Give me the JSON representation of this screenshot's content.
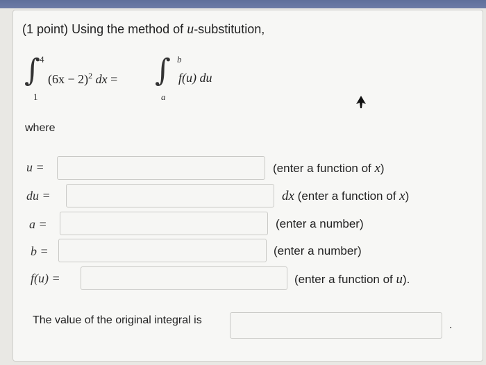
{
  "problem": {
    "points": "(1 point)",
    "intro": "Using the method of",
    "u_symbol": "u",
    "intro_end": "-substitution,"
  },
  "integral": {
    "lower": "1",
    "upper": "4",
    "integrand": "(6x − 2)",
    "exponent": "2",
    "dx": "dx",
    "equals": "=",
    "lower_sub": "a",
    "upper_sub": "b",
    "integrand_sub": "f(u) du"
  },
  "where_text": "where",
  "rows": [
    {
      "label": "u =",
      "value": "",
      "hint_pre": "",
      "hint_text": "(enter a function of ",
      "hint_var": "x",
      "hint_post": ")"
    },
    {
      "label": "du =",
      "value": "",
      "hint_pre": "dx",
      "hint_text": " (enter a function of ",
      "hint_var": "x",
      "hint_post": ")"
    },
    {
      "label": "a =",
      "value": "",
      "hint_pre": "",
      "hint_text": "(enter a number)",
      "hint_var": "",
      "hint_post": ""
    },
    {
      "label": "b =",
      "value": "",
      "hint_pre": "",
      "hint_text": "(enter a number)",
      "hint_var": "",
      "hint_post": ""
    },
    {
      "label": "f(u) =",
      "value": "",
      "hint_pre": "",
      "hint_text": "(enter a function of ",
      "hint_var": "u",
      "hint_post": ")."
    }
  ],
  "final": {
    "text": "The value of the original integral is",
    "value": "",
    "period": "."
  },
  "colors": {
    "background": "#e9e8e4",
    "card": "#f7f7f5",
    "field_border": "#c9c9c6"
  }
}
